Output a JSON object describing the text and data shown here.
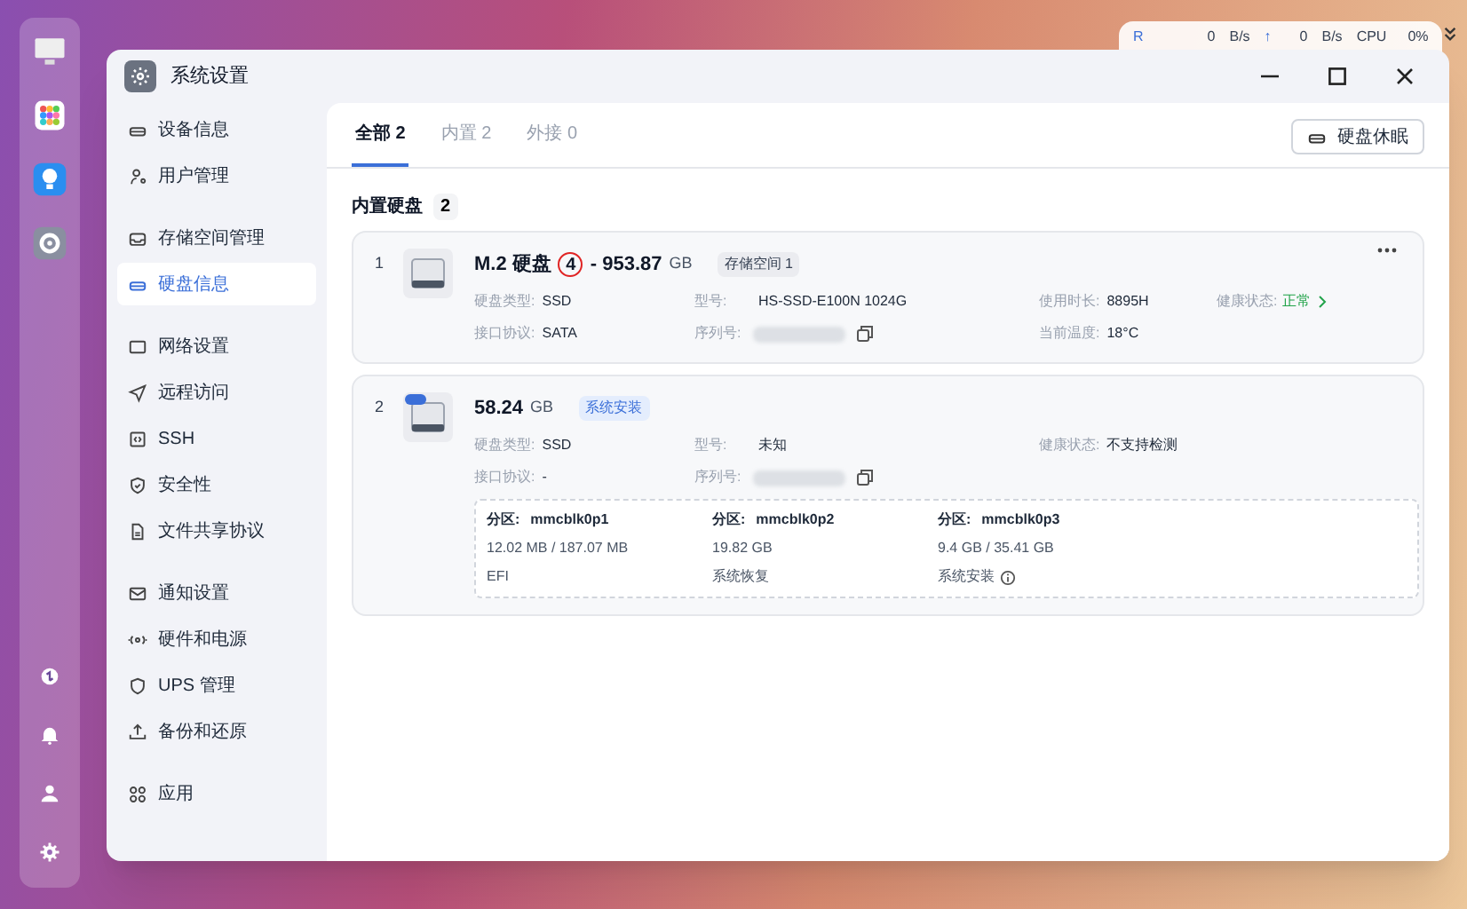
{
  "status_widget": {
    "read_label": "R",
    "read_value": "0",
    "read_unit": "B/s",
    "upload_icon": "↑",
    "upload_value": "0",
    "upload_unit": "B/s",
    "cpu_label": "CPU",
    "cpu_value": "0%"
  },
  "window": {
    "title": "系统设置"
  },
  "sidebar": {
    "groups": [
      [
        {
          "label": "设备信息",
          "selected": false
        },
        {
          "label": "用户管理",
          "selected": false
        }
      ],
      [
        {
          "label": "存储空间管理",
          "selected": false
        },
        {
          "label": "硬盘信息",
          "selected": true
        }
      ],
      [
        {
          "label": "网络设置",
          "selected": false
        },
        {
          "label": "远程访问",
          "selected": false
        },
        {
          "label": "SSH",
          "selected": false
        },
        {
          "label": "安全性",
          "selected": false
        },
        {
          "label": "文件共享协议",
          "selected": false
        }
      ],
      [
        {
          "label": "通知设置",
          "selected": false
        },
        {
          "label": "硬件和电源",
          "selected": false
        },
        {
          "label": "UPS 管理",
          "selected": false
        },
        {
          "label": "备份和还原",
          "selected": false
        }
      ],
      [
        {
          "label": "应用",
          "selected": false
        }
      ]
    ]
  },
  "tabs": [
    {
      "label": "全部 2",
      "selected": true
    },
    {
      "label": "内置 2",
      "selected": false
    },
    {
      "label": "外接 0",
      "selected": false
    }
  ],
  "sleep_button": "硬盘休眠",
  "section": {
    "title": "内置硬盘",
    "count": "2"
  },
  "disks": [
    {
      "kind": "data",
      "index": "1",
      "name": "M.2 硬盘",
      "slot": "4",
      "size": "- 953.87",
      "unit": "GB",
      "tag": {
        "label": "存储空间 1",
        "kind": "gray"
      },
      "rows": [
        [
          {
            "label": "硬盘类型:",
            "value": "SSD"
          },
          {
            "label": "型号:",
            "value": "HS-SSD-E100N 1024G"
          },
          {
            "label": "使用时长:",
            "value": "8895H"
          },
          {
            "label": "健康状态:",
            "value": "正常",
            "kind": "good"
          }
        ],
        [
          {
            "label": "接口协议:",
            "value": "SATA"
          },
          {
            "label": "序列号:",
            "kind": "serial"
          },
          {
            "label": "当前温度:",
            "value": "18°C"
          }
        ]
      ]
    },
    {
      "kind": "system",
      "index": "2",
      "size": "58.24",
      "unit": "GB",
      "tag": {
        "label": "系统安装",
        "kind": "blue"
      },
      "rows": [
        [
          {
            "label": "硬盘类型:",
            "value": "SSD"
          },
          {
            "label": "型号:",
            "value": "未知"
          },
          {
            "label": "健康状态:",
            "value": "不支持检测"
          }
        ],
        [
          {
            "label": "接口协议:",
            "value": "-"
          },
          {
            "label": "序列号:",
            "kind": "serial"
          }
        ]
      ],
      "partitions": [
        {
          "label": "分区:",
          "name": "mmcblk0p1",
          "usage": "12.02 MB / 187.07 MB",
          "purpose": "EFI",
          "info": false
        },
        {
          "label": "分区:",
          "name": "mmcblk0p2",
          "usage": "19.82 GB",
          "purpose": "系统恢复",
          "info": false
        },
        {
          "label": "分区:",
          "name": "mmcblk0p3",
          "usage": "9.4 GB / 35.41 GB",
          "purpose": "系统安装",
          "info": true
        }
      ]
    }
  ]
}
